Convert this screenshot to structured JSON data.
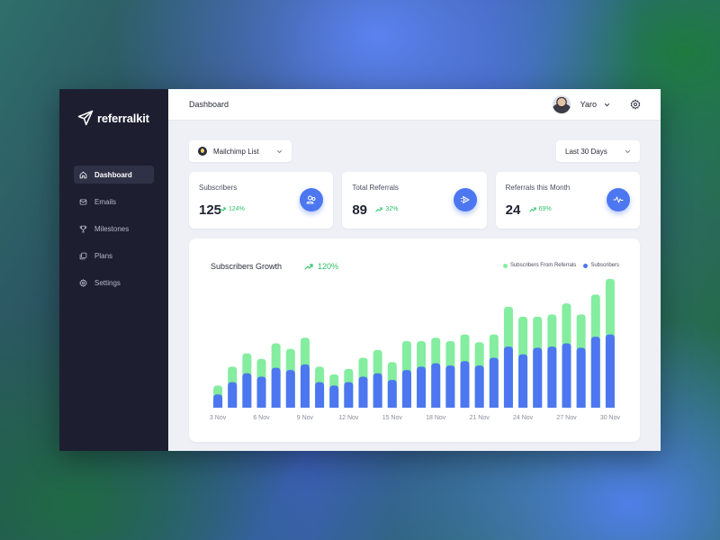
{
  "app": {
    "brand": "referralkit"
  },
  "sidebar": {
    "items": [
      {
        "label": "Dashboard",
        "icon": "home-icon",
        "active": true
      },
      {
        "label": "Emails",
        "icon": "mail-icon",
        "active": false
      },
      {
        "label": "Milestones",
        "icon": "trophy-icon",
        "active": false
      },
      {
        "label": "Plans",
        "icon": "layers-icon",
        "active": false
      },
      {
        "label": "Settings",
        "icon": "gear-icon",
        "active": false
      }
    ]
  },
  "topbar": {
    "title": "Dashboard",
    "user_name": "Yaro"
  },
  "controls": {
    "list_selected": "Mailchimp List",
    "range_selected": "Last 30 Days"
  },
  "cards": [
    {
      "label": "Subscribers",
      "value": "125",
      "trend": "124%",
      "icon": "users-icon"
    },
    {
      "label": "Total Referrals",
      "value": "89",
      "trend": "32%",
      "icon": "send-icon"
    },
    {
      "label": "Referrals this Month",
      "value": "24",
      "trend": "69%",
      "icon": "activity-icon"
    }
  ],
  "colors": {
    "accent": "#4c77f0",
    "green": "#84ed9f",
    "positive": "#2ec26a",
    "sidebar": "#1d1f31"
  },
  "chart": {
    "title": "Subscribers Growth",
    "growth": "120%",
    "legend": [
      "Subscribers From Referrals",
      "Subscribers"
    ]
  },
  "chart_data": {
    "type": "bar",
    "stacked": true,
    "categories": [
      "3 Nov",
      "4 Nov",
      "5 Nov",
      "6 Nov",
      "7 Nov",
      "8 Nov",
      "9 Nov",
      "10 Nov",
      "11 Nov",
      "12 Nov",
      "13 Nov",
      "14 Nov",
      "15 Nov",
      "16 Nov",
      "17 Nov",
      "18 Nov",
      "19 Nov",
      "20 Nov",
      "21 Nov",
      "22 Nov",
      "23 Nov",
      "24 Nov",
      "25 Nov",
      "26 Nov",
      "27 Nov",
      "28 Nov",
      "29 Nov",
      "30 Nov"
    ],
    "tick_labels": [
      "3 Nov",
      "6 Nov",
      "9 Nov",
      "12 Nov",
      "15 Nov",
      "18 Nov",
      "21 Nov",
      "24 Nov",
      "27 Nov",
      "30 Nov"
    ],
    "series": [
      {
        "name": "Subscribers",
        "values": [
          12,
          23,
          31,
          28,
          36,
          34,
          39,
          23,
          20,
          23,
          28,
          31,
          25,
          34,
          37,
          40,
          38,
          42,
          38,
          45,
          55,
          48,
          54,
          55,
          58,
          54,
          64,
          66
        ]
      },
      {
        "name": "Subscribers From Referrals",
        "values": [
          8,
          14,
          18,
          16,
          22,
          19,
          24,
          14,
          10,
          12,
          17,
          21,
          16,
          26,
          23,
          23,
          22,
          24,
          21,
          21,
          36,
          34,
          28,
          29,
          36,
          30,
          38,
          50
        ]
      }
    ],
    "ylim": [
      0,
      120
    ],
    "grid": false,
    "legend_position": "top-right"
  }
}
